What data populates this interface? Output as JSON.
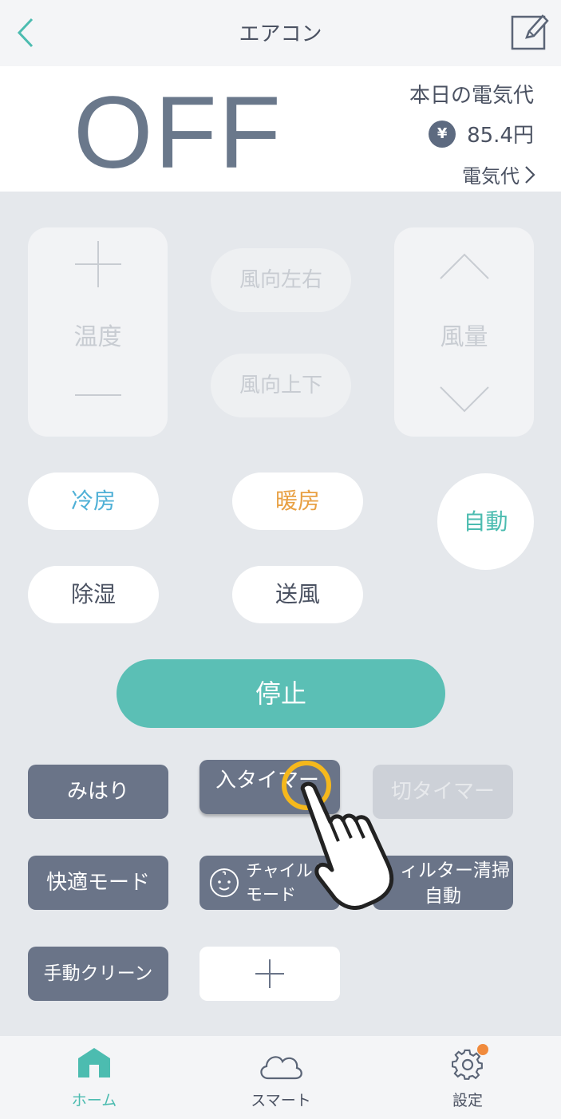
{
  "header": {
    "title": "エアコン",
    "back_icon": "chevron-left-icon",
    "edit_icon": "edit-icon"
  },
  "status": {
    "power": "OFF",
    "electricity_label": "本日の電気代",
    "currency_symbol": "¥",
    "price": "85.4円",
    "link": "電気代"
  },
  "controls": {
    "temperature_label": "温度",
    "direction_lr": "風向左右",
    "direction_ud": "風向上下",
    "fan_label": "風量"
  },
  "modes": {
    "cool": "冷房",
    "heat": "暖房",
    "auto": "自動",
    "dry": "除湿",
    "fan": "送風"
  },
  "colors": {
    "cool": "#4fb0d6",
    "heat": "#e8a043",
    "auto": "#4cbcb0",
    "accent": "#5bbfb5",
    "badge": "#f08a3c"
  },
  "stop_label": "停止",
  "functions": {
    "watch": "みはり",
    "on_timer": "入タイマー",
    "off_timer": "切タイマー",
    "comfort": "快適モード",
    "child_line1": "チャイルド",
    "child_line2": "モード",
    "filter_line1": "ィルター清掃",
    "filter_line2": "自動",
    "manual_clean": "手動クリーン"
  },
  "nav": {
    "home": "ホーム",
    "smart": "スマート",
    "settings": "設定"
  }
}
